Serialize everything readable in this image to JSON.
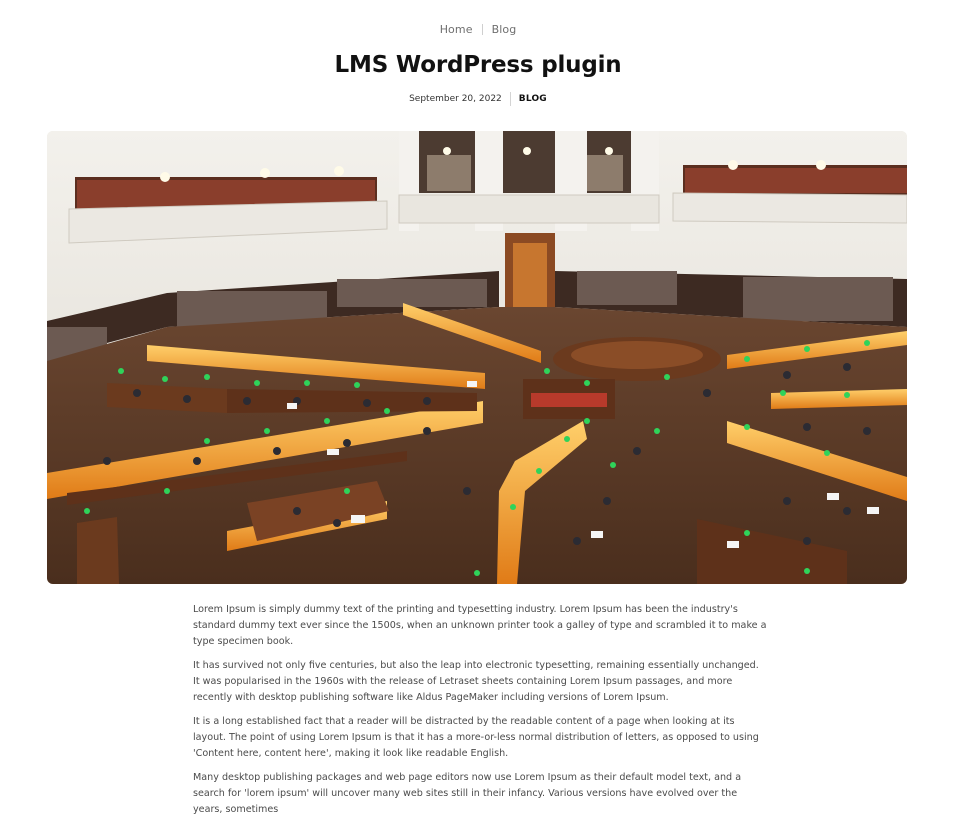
{
  "breadcrumb": {
    "home": "Home",
    "blog": "Blog"
  },
  "post": {
    "title": "LMS WordPress plugin",
    "date": "September 20, 2022",
    "category": "BLOG"
  },
  "featured_image": {
    "subject": "library-reading-room-photo"
  },
  "body": {
    "paragraphs": [
      "Lorem Ipsum is simply dummy text of the printing and typesetting industry. Lorem Ipsum has been the industry's standard dummy text ever since the 1500s, when an unknown printer took a galley of type and scrambled it to make a type specimen book.",
      "It has survived not only five centuries, but also the leap into electronic typesetting, remaining essentially unchanged. It was popularised in the 1960s with the release of Letraset sheets containing Lorem Ipsum passages, and more recently with desktop publishing software like Aldus PageMaker including versions of Lorem Ipsum.",
      "It is a long established fact that a reader will be distracted by the readable content of a page when looking at its layout. The point of using Lorem Ipsum is that it has a more-or-less normal distribution of letters, as opposed to using 'Content here, content here', making it look like readable English.",
      "Many desktop publishing packages and web page editors now use Lorem Ipsum as their default model text, and a search for 'lorem ipsum' will uncover many web sites still in their infancy. Various versions have evolved over the years, sometimes"
    ]
  },
  "colors": {
    "title": "#111111",
    "muted": "#6f6f6f",
    "body_text": "#4b4b4b",
    "wall": "#eeece6",
    "wood": "#6b3a1e",
    "lamp_glow": "#f7a233",
    "lamp_green": "#2fd35a",
    "floor": "#5a3a26"
  }
}
